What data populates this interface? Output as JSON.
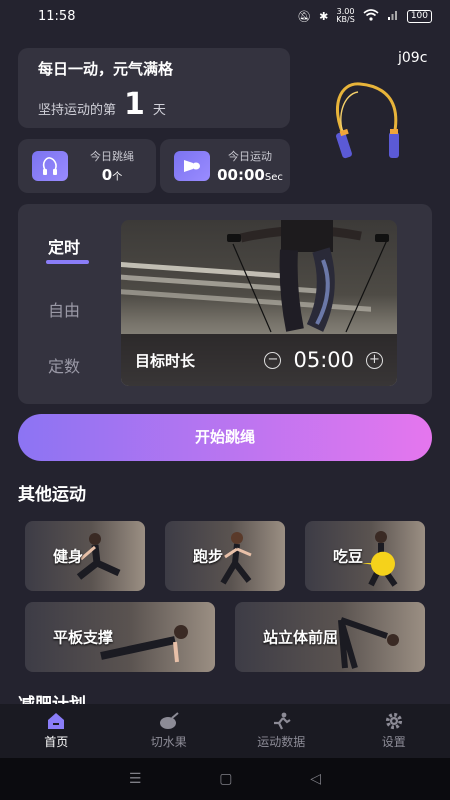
{
  "status": {
    "time": "11:58",
    "speed": "3.00\nKB/S",
    "battery": "100"
  },
  "hero": {
    "title": "每日一动，元气满格",
    "streak_prefix": "坚持运动的第",
    "streak_days": "1",
    "streak_suffix": "天"
  },
  "user_id": "j09c",
  "stats": {
    "rope": {
      "label": "今日跳绳",
      "value": "0",
      "unit": "个"
    },
    "exercise": {
      "label": "今日运动",
      "value": "00:00",
      "unit": "Sec"
    }
  },
  "modes": {
    "tabs": [
      "定时",
      "自由",
      "定数"
    ],
    "active": "定时"
  },
  "target": {
    "label": "目标时长",
    "value": "05:00",
    "minus": "−",
    "plus": "+"
  },
  "start_label": "开始跳绳",
  "section_title": "其他运动",
  "exercises": [
    "健身",
    "跑步",
    "吃豆",
    "平板支撑",
    "站立体前屈"
  ],
  "plan_title": "减肥计划",
  "nav": [
    "首页",
    "切水果",
    "运动数据",
    "设置"
  ],
  "colors": {
    "accent": "#8a7df8",
    "gradient_start": "#8c74f3",
    "gradient_end": "#e576ee",
    "background": "#24232f"
  }
}
